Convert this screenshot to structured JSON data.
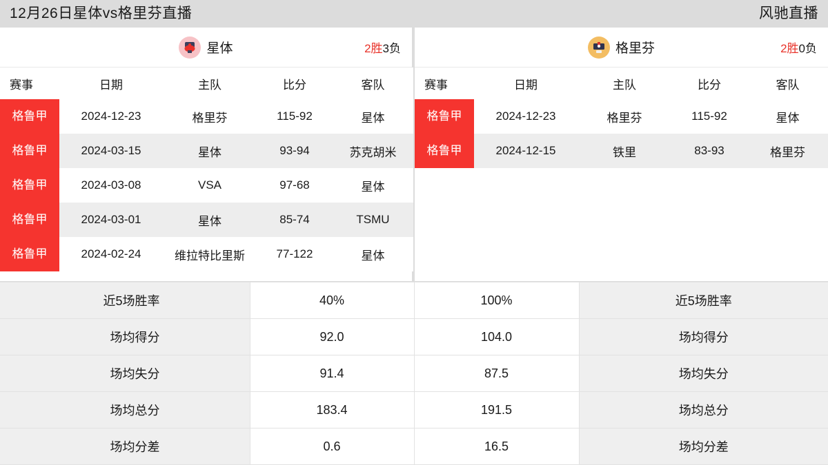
{
  "topbar": {
    "title": "12月26日星体vs格里芬直播",
    "brand": "风驰直播"
  },
  "left_panel": {
    "team": {
      "name": "星体",
      "avatar_icon": "team-crest-icon",
      "avatar_color": "#f7c2c6",
      "record_win": "2胜",
      "record_loss": "3负"
    },
    "columns": [
      "赛事",
      "日期",
      "主队",
      "比分",
      "客队"
    ],
    "rows": [
      {
        "league": "格鲁甲",
        "date": "2024-12-23",
        "home": "格里芬",
        "score": "115-92",
        "away": "星体"
      },
      {
        "league": "格鲁甲",
        "date": "2024-03-15",
        "home": "星体",
        "score": "93-94",
        "away": "苏克胡米"
      },
      {
        "league": "格鲁甲",
        "date": "2024-03-08",
        "home": "VSA",
        "score": "97-68",
        "away": "星体"
      },
      {
        "league": "格鲁甲",
        "date": "2024-03-01",
        "home": "星体",
        "score": "85-74",
        "away": "TSMU"
      },
      {
        "league": "格鲁甲",
        "date": "2024-02-24",
        "home": "维拉特比里斯",
        "score": "77-122",
        "away": "星体"
      }
    ]
  },
  "right_panel": {
    "team": {
      "name": "格里芬",
      "avatar_icon": "team-crest-icon",
      "avatar_color": "#f3bd62",
      "record_win": "2胜",
      "record_loss": "0负"
    },
    "columns": [
      "赛事",
      "日期",
      "主队",
      "比分",
      "客队"
    ],
    "rows": [
      {
        "league": "格鲁甲",
        "date": "2024-12-23",
        "home": "格里芬",
        "score": "115-92",
        "away": "星体"
      },
      {
        "league": "格鲁甲",
        "date": "2024-12-15",
        "home": "铁里",
        "score": "83-93",
        "away": "格里芬"
      }
    ]
  },
  "stats": [
    {
      "label_left": "近5场胜率",
      "value_left": "40%",
      "value_right": "100%",
      "label_right": "近5场胜率"
    },
    {
      "label_left": "场均得分",
      "value_left": "92.0",
      "value_right": "104.0",
      "label_right": "场均得分"
    },
    {
      "label_left": "场均失分",
      "value_left": "91.4",
      "value_right": "87.5",
      "label_right": "场均失分"
    },
    {
      "label_left": "场均总分",
      "value_left": "183.4",
      "value_right": "191.5",
      "label_right": "场均总分"
    },
    {
      "label_left": "场均分差",
      "value_left": "0.6",
      "value_right": "16.5",
      "label_right": "场均分差"
    }
  ],
  "theme": {
    "league_badge_bg": "#f5342f",
    "win_color": "#e8332a",
    "page_bg": "#dcdcdc",
    "row_alt_bg": "#ededed",
    "stat_label_bg": "#efefef"
  }
}
